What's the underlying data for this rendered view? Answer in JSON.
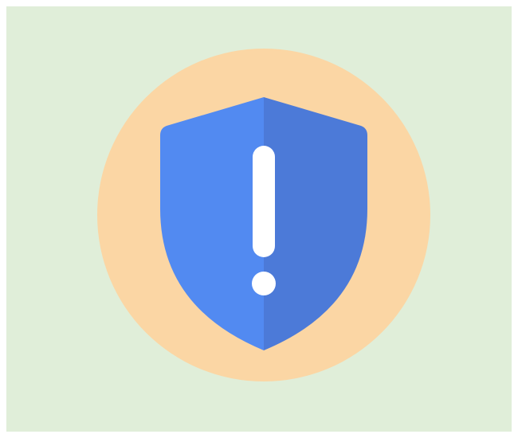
{
  "illustration": {
    "icon": "shield-exclamation-icon",
    "colors": {
      "page_background": "#e0eed9",
      "circle": "#fbd6a4",
      "shield_left": "#528af1",
      "shield_right": "#4c7ad8",
      "exclamation": "#ffffff"
    }
  }
}
